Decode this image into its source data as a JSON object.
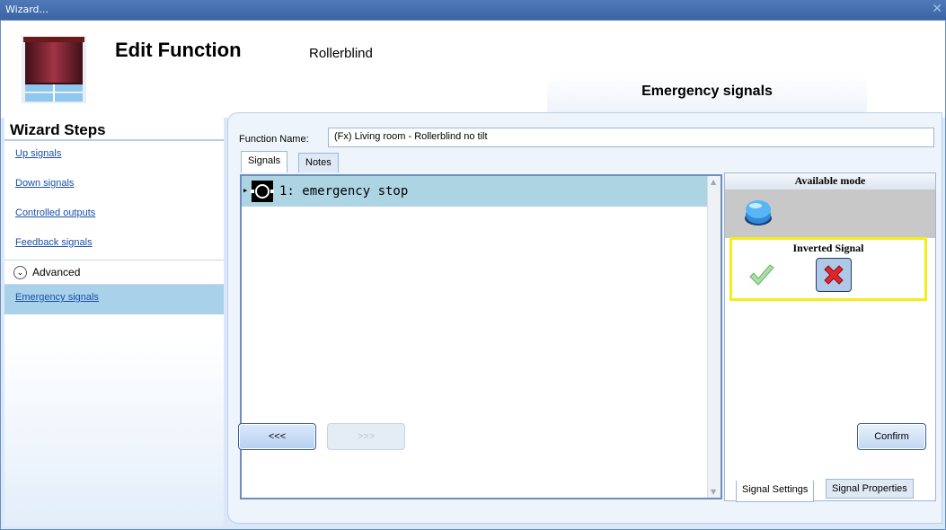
{
  "window": {
    "title": "Wizard...",
    "close_label": "✕"
  },
  "header": {
    "title": "Edit Function",
    "function_type": "Rollerblind",
    "step_tab": "Emergency signals"
  },
  "sidebar": {
    "heading": "Wizard Steps",
    "items": [
      {
        "label": "Up signals"
      },
      {
        "label": "Down signals"
      },
      {
        "label": "Controlled outputs"
      },
      {
        "label": "Feedback signals"
      }
    ],
    "advanced_label": "Advanced",
    "active_item": "Emergency signals"
  },
  "form": {
    "function_name_label": "Function Name:",
    "function_name_value": "(Fx) Living room - Rollerblind no tilt"
  },
  "tabs": {
    "signals": "Signals",
    "notes": "Notes"
  },
  "signals": [
    {
      "label": "1: emergency stop"
    }
  ],
  "right_panel": {
    "available_mode": "Available mode",
    "inverted_signal": "Inverted Signal",
    "tab_settings": "Signal Settings",
    "tab_properties": "Signal Properties"
  },
  "buttons": {
    "prev": "<<<",
    "next": ">>>",
    "confirm": "Confirm"
  },
  "colors": {
    "highlight_box": "#f4ee1c",
    "selected_row": "#add4e3",
    "link": "#1b4fa8"
  }
}
